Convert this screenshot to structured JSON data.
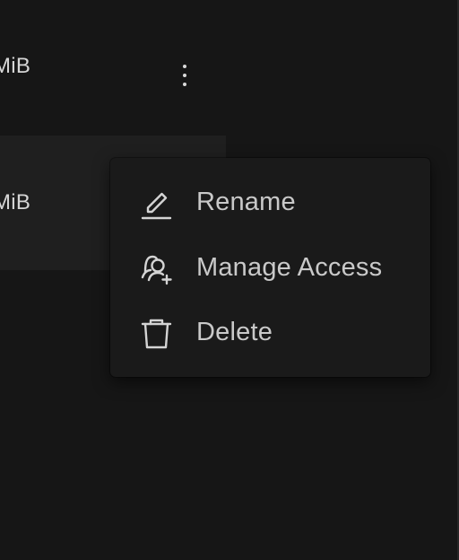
{
  "rows": [
    {
      "size": "MiB"
    },
    {
      "size": "MiB"
    }
  ],
  "row_actions": {
    "icon": "more-vertical-icon"
  },
  "menu": {
    "items": [
      {
        "label": "Rename",
        "icon": "pencil-icon"
      },
      {
        "label": "Manage Access",
        "icon": "user-add-icon"
      },
      {
        "label": "Delete",
        "icon": "trash-icon"
      }
    ]
  },
  "colors": {
    "background": "#161616",
    "selected_row": "#1f1f1f",
    "menu_background": "#1a1a1a",
    "text": "#c9c9c9"
  }
}
